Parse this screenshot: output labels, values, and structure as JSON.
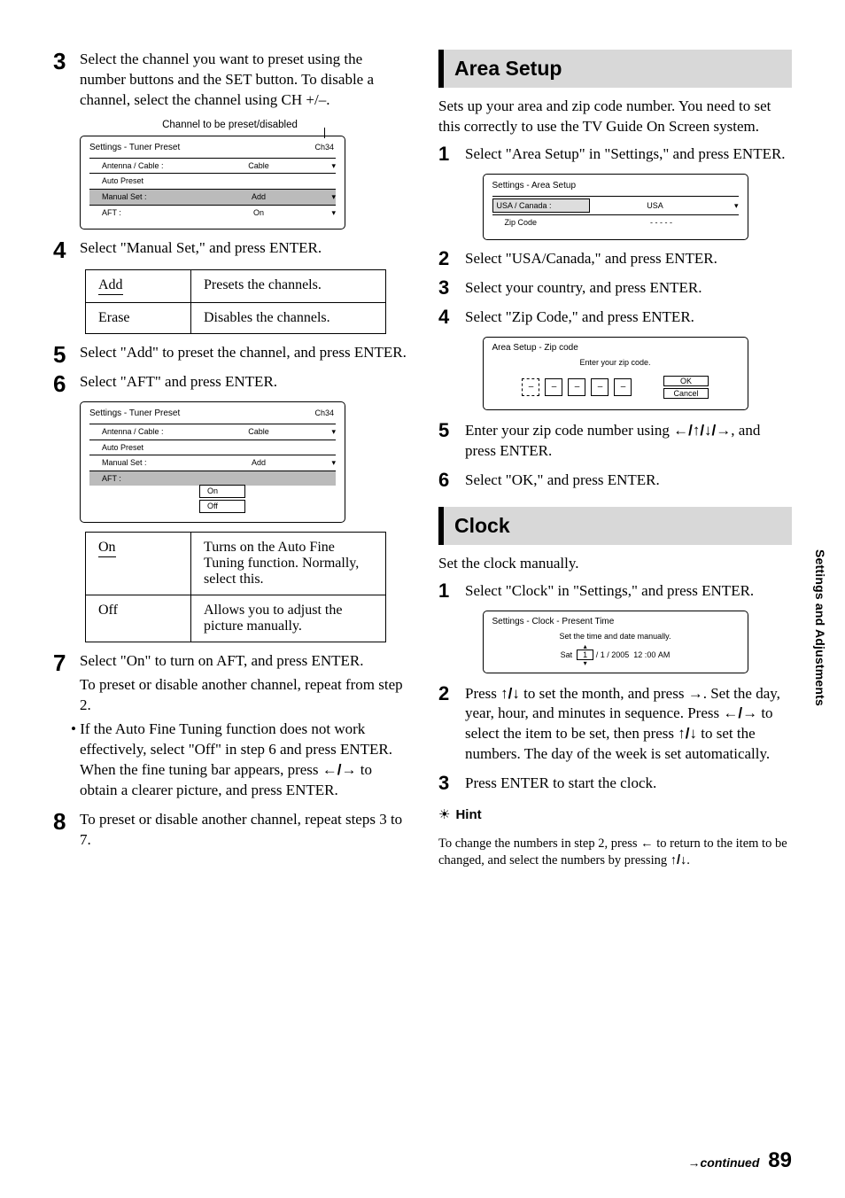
{
  "page_number": "89",
  "continued": "continued",
  "side_tab": "Settings and Adjustments",
  "left": {
    "step3": "Select the channel you want to preset using the number buttons and the SET button. To disable a channel, select the channel using CH +/–.",
    "note_ch": "Channel to be preset/disabled",
    "ui1": {
      "title": "Settings - Tuner Preset",
      "ch": "Ch34",
      "rows": [
        {
          "k": "Antenna / Cable :",
          "v": "Cable",
          "arr": "▾"
        },
        {
          "k": "Auto Preset",
          "v": "",
          "arr": ""
        },
        {
          "k": "Manual Set :",
          "v": "Add",
          "arr": "▾",
          "sel": true
        },
        {
          "k": "AFT :",
          "v": "On",
          "arr": "▾"
        }
      ]
    },
    "step4": "Select \"Manual Set,\" and press ENTER.",
    "tbl1": {
      "r1k": "Add",
      "r1v": "Presets the channels.",
      "r2k": "Erase",
      "r2v": "Disables the channels."
    },
    "step5": "Select \"Add\" to preset the channel, and press ENTER.",
    "step6": "Select \"AFT\" and press ENTER.",
    "ui2": {
      "title": "Settings - Tuner Preset",
      "ch": "Ch34",
      "rows": [
        {
          "k": "Antenna / Cable :",
          "v": "Cable",
          "arr": "▾"
        },
        {
          "k": "Auto Preset",
          "v": "",
          "arr": ""
        },
        {
          "k": "Manual Set :",
          "v": "Add",
          "arr": "▾"
        },
        {
          "k": "AFT :",
          "v": "",
          "arr": "",
          "sel": true
        }
      ],
      "opt1": "On",
      "opt2": "Off"
    },
    "tbl2": {
      "r1k": "On",
      "r1v": "Turns on the Auto Fine Tuning function. Normally, select this.",
      "r2k": "Off",
      "r2v": "Allows you to adjust the picture manually."
    },
    "step7a": "Select \"On\" to turn on AFT, and press ENTER.",
    "step7b": "To preset or disable another channel, repeat from step 2.",
    "step7_bullet_a": "• If the Auto Fine Tuning function does not work effectively, select \"Off\" in step 6 and press ENTER. When the fine tuning bar appears, press ",
    "step7_bullet_b": " to obtain a clearer picture, and press ENTER.",
    "step8": "To preset or disable another channel, repeat steps 3 to 7."
  },
  "right": {
    "area_head": "Area Setup",
    "area_intro": "Sets up your area and zip code number. You need to set this correctly to use the TV Guide On Screen system.",
    "a1": "Select \"Area Setup\" in \"Settings,\" and press ENTER.",
    "ui_area": {
      "title": "Settings - Area Setup",
      "rows": [
        {
          "k": "USA / Canada :",
          "v": "USA",
          "arr": "▾",
          "sel": true
        },
        {
          "k": "Zip Code",
          "v": "- - - - -",
          "arr": ""
        }
      ]
    },
    "a2": "Select \"USA/Canada,\" and press ENTER.",
    "a3": "Select your country, and press ENTER.",
    "a4": "Select \"Zip Code,\" and press ENTER.",
    "ui_zip": {
      "title": "Area Setup - Zip code",
      "msg": "Enter your zip code.",
      "d": "–",
      "ok": "OK",
      "cancel": "Cancel"
    },
    "a5a": "Enter your zip code number using ",
    "a5b": ", and press ENTER.",
    "a6": "Select \"OK,\" and press ENTER.",
    "clock_head": "Clock",
    "clock_intro": "Set the clock manually.",
    "c1": "Select \"Clock\" in \"Settings,\" and press ENTER.",
    "ui_clock": {
      "title": "Settings - Clock - Present Time",
      "msg": "Set the time and date manually.",
      "dow": "Sat",
      "m": "1",
      "d": "1",
      "y": "2005",
      "h": "12",
      "mi": "00",
      "ap": "AM"
    },
    "c2a": "Press ",
    "c2b": " to set the month, and press ",
    "c2c": ". Set the day, year, hour, and minutes in sequence. Press ",
    "c2d": " to select the item to be set, then press ",
    "c2e": " to set the numbers. The day of the week is set automatically.",
    "c3": "Press ENTER to start the clock.",
    "hint_h": "Hint",
    "hint_a": "To change the numbers in step 2, press ",
    "hint_b": " to return to the item to be changed, and select the numbers by pressing ",
    "hint_c": "."
  }
}
